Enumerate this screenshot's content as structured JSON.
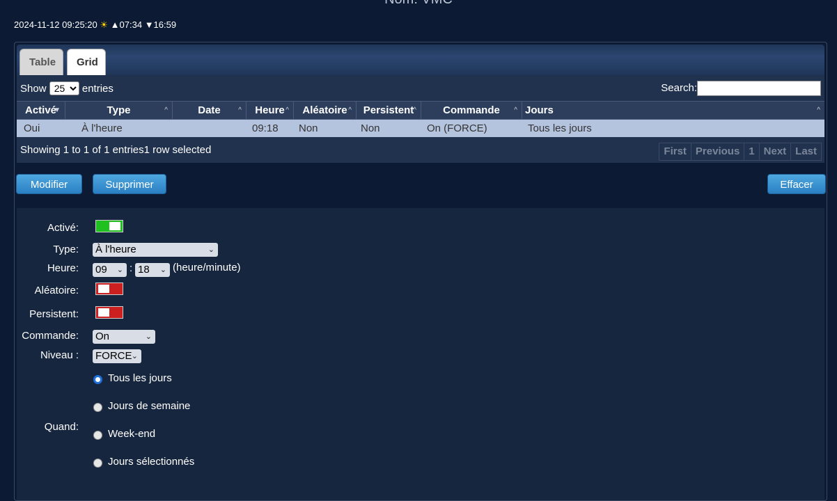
{
  "page": {
    "title": "Nom: VMC"
  },
  "clock": {
    "datetime": "2024-11-12 09:25:20",
    "sun_icon": "☀",
    "sunrise": "▲07:34",
    "sunset": "▼16:59"
  },
  "tabs": {
    "table": "Table",
    "grid": "Grid"
  },
  "table_controls": {
    "show_label": "Show",
    "show_value": "25",
    "entries_label": "entries",
    "search_label": "Search:",
    "search_value": ""
  },
  "columns": [
    "Activé",
    "Type",
    "Date",
    "Heure",
    "Aléatoire",
    "Persistent",
    "Commande",
    "Jours"
  ],
  "rows": [
    {
      "active": "Oui",
      "type": "À l'heure",
      "date": "",
      "heure": "09:18",
      "aleatoire": "Non",
      "persistent": "Non",
      "commande": "On (FORCE)",
      "jours": "Tous les jours"
    }
  ],
  "footer": {
    "info": "Showing 1 to 1 of 1 entries1 row selected"
  },
  "pager": {
    "first": "First",
    "previous": "Previous",
    "page": "1",
    "next": "Next",
    "last": "Last"
  },
  "buttons": {
    "modifier": "Modifier",
    "supprimer": "Supprimer",
    "effacer": "Effacer"
  },
  "form": {
    "active_label": "Activé:",
    "type_label": "Type:",
    "type_value": "À l'heure",
    "heure_label": "Heure:",
    "hour_value": "09",
    "colon": ":",
    "minute_value": "18",
    "heure_hint": "(heure/minute)",
    "aleatoire_label": "Aléatoire:",
    "persistent_label": "Persistent:",
    "commande_label": "Commande:",
    "commande_value": "On",
    "niveau_label": "Niveau :",
    "niveau_value": "FORCE",
    "quand_label": "Quand:",
    "when_options": [
      "Tous les jours",
      "Jours de semaine",
      "Week-end",
      "Jours sélectionnés"
    ],
    "when_selected": "Tous les jours",
    "active_on": true,
    "aleatoire_on": false,
    "persistent_on": false
  },
  "colors": {
    "background": "#0c1a33",
    "button": "#2a7fc2",
    "toggle_on": "#20c020",
    "toggle_off": "#cc2020",
    "selected_row": "#b4c3de"
  }
}
